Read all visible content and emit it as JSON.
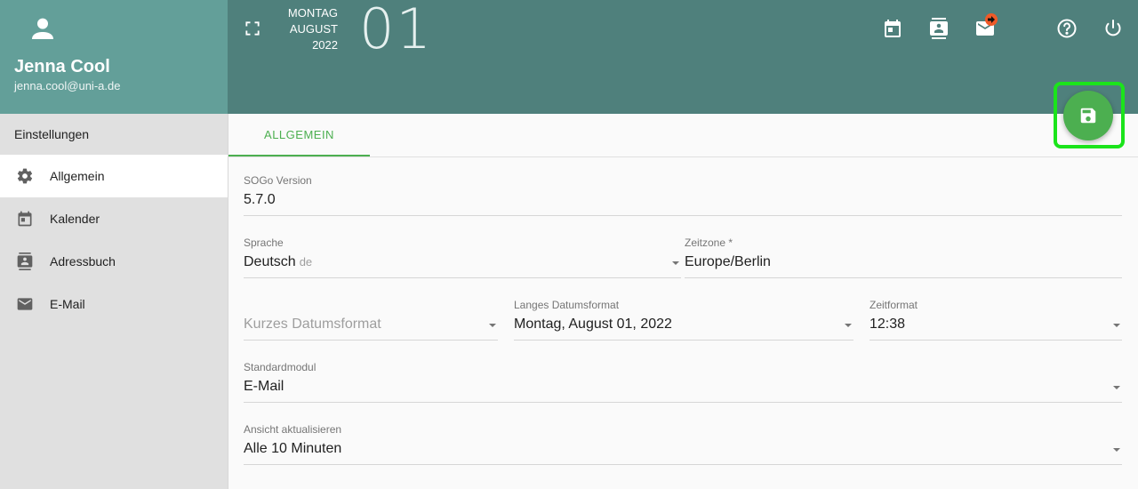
{
  "user": {
    "name": "Jenna Cool",
    "email": "jenna.cool@uni-a.de"
  },
  "sidebar": {
    "title": "Einstellungen",
    "items": [
      {
        "label": "Allgemein",
        "icon": "gear-icon",
        "active": true
      },
      {
        "label": "Kalender",
        "icon": "calendar-icon",
        "active": false
      },
      {
        "label": "Adressbuch",
        "icon": "contacts-icon",
        "active": false
      },
      {
        "label": "E-Mail",
        "icon": "mail-icon",
        "active": false
      }
    ]
  },
  "header": {
    "weekday": "MONTAG",
    "month": "AUGUST",
    "year": "2022",
    "day": "01",
    "icons": [
      "fullscreen-icon",
      "calendar-icon",
      "contacts-icon",
      "mail-icon",
      "help-icon",
      "power-icon"
    ]
  },
  "tabs": [
    {
      "label": "ALLGEMEIN"
    }
  ],
  "form": {
    "sogo_version": {
      "label": "SOGo Version",
      "value": "5.7.0"
    },
    "language": {
      "label": "Sprache",
      "value": "Deutsch",
      "code": "de"
    },
    "timezone": {
      "label": "Zeitzone *",
      "value": "Europe/Berlin"
    },
    "short_date": {
      "placeholder": "Kurzes Datumsformat"
    },
    "long_date": {
      "label": "Langes Datumsformat",
      "value": "Montag, August 01, 2022"
    },
    "time_format": {
      "label": "Zeitformat",
      "value": "12:38"
    },
    "default_module": {
      "label": "Standardmodul",
      "value": "E-Mail"
    },
    "refresh_view": {
      "label": "Ansicht aktualisieren",
      "value": "Alle 10 Minuten"
    }
  },
  "colors": {
    "accent": "#4caf50",
    "header": "#4f807c",
    "user_card": "#639f99",
    "highlight": "#1be41b"
  }
}
